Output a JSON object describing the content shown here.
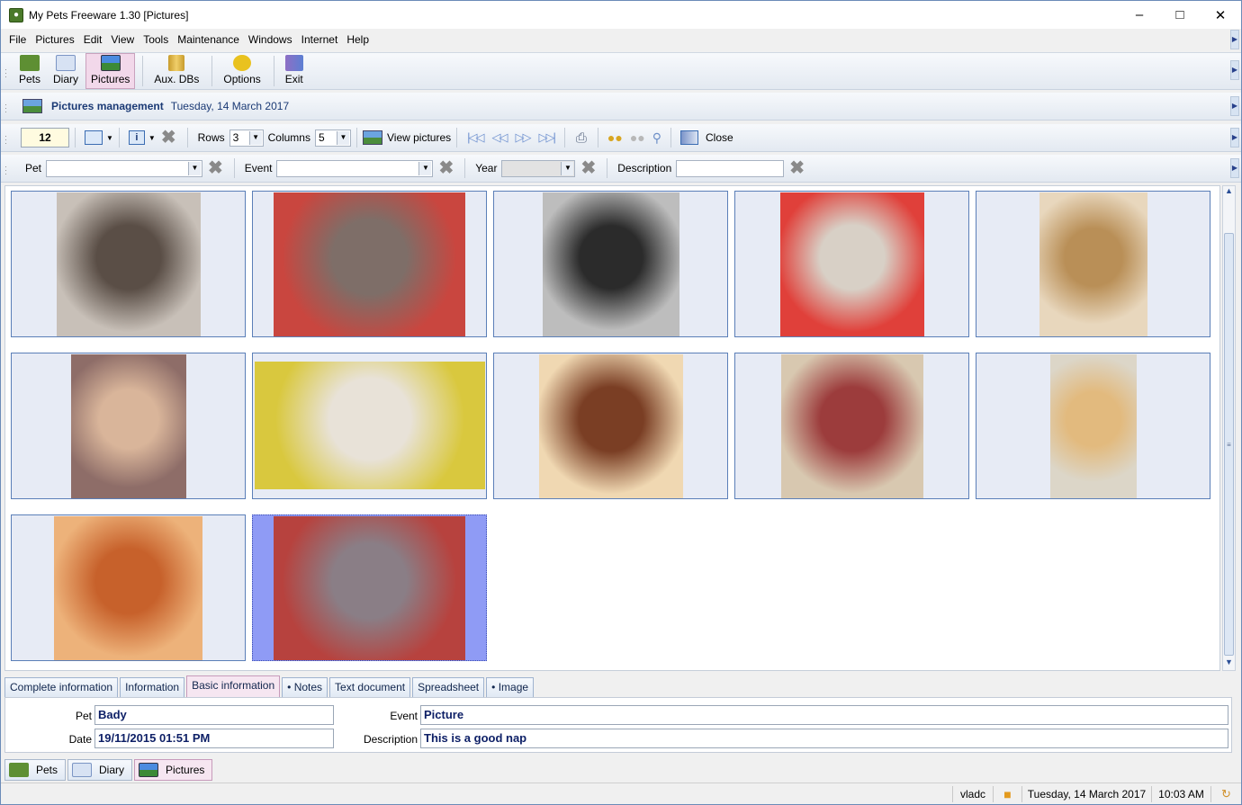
{
  "window": {
    "title": "My Pets Freeware 1.30 [Pictures]"
  },
  "menu": [
    "File",
    "Pictures",
    "Edit",
    "View",
    "Tools",
    "Maintenance",
    "Windows",
    "Internet",
    "Help"
  ],
  "toolbar": {
    "pets": "Pets",
    "diary": "Diary",
    "pictures": "Pictures",
    "aux": "Aux. DBs",
    "options": "Options",
    "exit": "Exit"
  },
  "header": {
    "title": "Pictures management",
    "date": "Tuesday, 14 March 2017"
  },
  "picbar": {
    "count": "12",
    "rows_label": "Rows",
    "rows_value": "3",
    "columns_label": "Columns",
    "columns_value": "5",
    "view_pictures": "View pictures",
    "close": "Close"
  },
  "filter": {
    "pet_label": "Pet",
    "event_label": "Event",
    "year_label": "Year",
    "description_label": "Description",
    "pet_value": "",
    "event_value": "",
    "year_value": "",
    "description_value": ""
  },
  "thumbnails": [
    {
      "c1": "#5a4e46",
      "c2": "#c8c0b8",
      "w": 160
    },
    {
      "c1": "#7e6e68",
      "c2": "#c9463f",
      "w": 213
    },
    {
      "c1": "#2b2b2b",
      "c2": "#bdbdbd",
      "w": 152
    },
    {
      "c1": "#d8d0c6",
      "c2": "#e0403a",
      "w": 160
    },
    {
      "c1": "#b98f57",
      "c2": "#e8d7bd",
      "w": 120
    },
    {
      "c1": "#d9b59a",
      "c2": "#8e6d68",
      "w": 128
    },
    {
      "c1": "#e8e2d8",
      "c2": "#d9c83e",
      "w": 256
    },
    {
      "c1": "#7a3e24",
      "c2": "#f0d8b2",
      "w": 160
    },
    {
      "c1": "#9c3c3c",
      "c2": "#d8c8b0",
      "w": 158
    },
    {
      "c1": "#e2ba7e",
      "c2": "#dcd6c8",
      "w": 96
    },
    {
      "c1": "#c7612b",
      "c2": "#edb27a",
      "w": 165
    },
    {
      "c1": "#8a7e86",
      "c2": "#b7423e",
      "w": 213
    }
  ],
  "tabs": [
    "Complete information",
    "Information",
    "Basic information",
    "Notes",
    "Text document",
    "Spreadsheet",
    "Image"
  ],
  "details": {
    "pet_label": "Pet",
    "pet_value": "Bady",
    "date_label": "Date",
    "date_value": "19/11/2015 01:51 PM",
    "event_label": "Event",
    "event_value": "Picture",
    "description_label": "Description",
    "description_value": "This is a good nap"
  },
  "nav_tabs": [
    "Pets",
    "Diary",
    "Pictures"
  ],
  "status": {
    "user": "vladc",
    "date": "Tuesday, 14 March 2017",
    "time": "10:03 AM"
  },
  "colors": {
    "accent": "#1b3a75",
    "selected_tab": "#f6e6f1",
    "selected_cell": "#8f9bf5"
  }
}
